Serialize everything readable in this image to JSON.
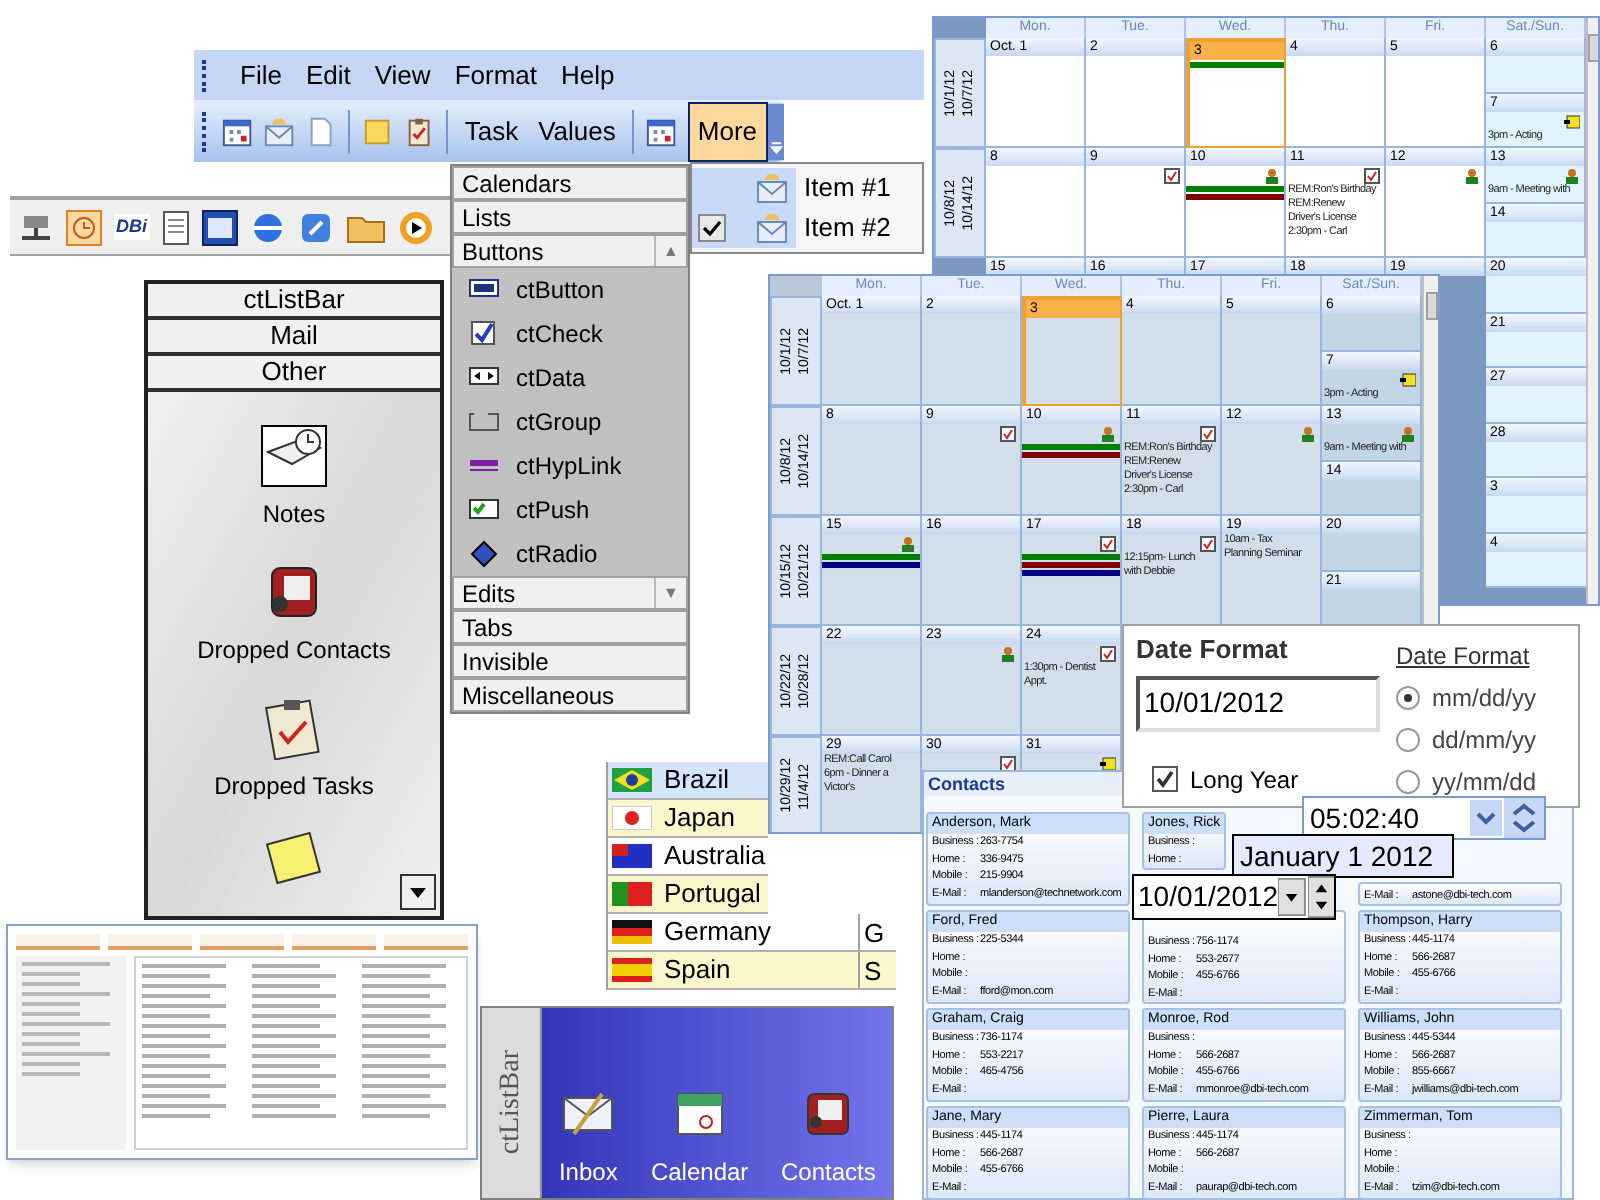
{
  "toolbar_window": {
    "menu": [
      {
        "label": "File"
      },
      {
        "label": "Edit"
      },
      {
        "label": "View"
      },
      {
        "label": "Format"
      },
      {
        "label": "Help"
      }
    ],
    "text_buttons": [
      {
        "label": "Task",
        "selected": false
      },
      {
        "label": "Values",
        "selected": false
      }
    ],
    "more_button": {
      "label": "More",
      "selected": true
    }
  },
  "more_menu": {
    "items": [
      {
        "label": "Item #1",
        "checked": false
      },
      {
        "label": "Item #2",
        "checked": true
      }
    ]
  },
  "quick_launch": {
    "logo": "DBi"
  },
  "group_bar": {
    "groups": [
      {
        "label": "Calendars"
      },
      {
        "label": "Lists"
      },
      {
        "label": "Buttons",
        "arrow": "▲",
        "items": [
          "ctButton",
          "ctCheck",
          "ctData",
          "ctGroup",
          "ctHypLink",
          "ctPush",
          "ctRadio"
        ]
      },
      {
        "label": "Edits",
        "arrow": "▼"
      },
      {
        "label": "Tabs"
      },
      {
        "label": "Invisible"
      },
      {
        "label": "Miscellaneous"
      }
    ]
  },
  "outlook_bar": {
    "groups": [
      "ctListBar",
      "Mail",
      "Other"
    ],
    "items": [
      "Notes",
      "Dropped Contacts",
      "Dropped Tasks"
    ]
  },
  "country_list": {
    "rows": [
      {
        "name": "Brazil",
        "selected": true
      },
      {
        "name": "Japan",
        "selected": false
      },
      {
        "name": "Australia",
        "selected": false
      },
      {
        "name": "Portugal",
        "selected": false
      },
      {
        "name": "Germany",
        "column_2": "G",
        "selected": false
      },
      {
        "name": "Spain",
        "column_2": "S",
        "selected": false
      }
    ]
  },
  "calendar_back": {
    "days": [
      "Mon.",
      "Tue.",
      "Wed.",
      "Thu.",
      "Fri.",
      "Sat./Sun."
    ],
    "weeks": [
      {
        "range": [
          "10/1/12",
          "10/7/12"
        ],
        "days": [
          {
            "label": "Oct. 1",
            "selected": false
          },
          {
            "label": "2",
            "selected": false
          },
          {
            "label": "3",
            "selected": true,
            "events": [
              {
                "kind": "bar",
                "color": "#008000"
              }
            ]
          },
          {
            "label": "4",
            "selected": false
          },
          {
            "label": "5",
            "selected": false
          },
          {
            "label": "6",
            "selected": false
          },
          {
            "label": "7",
            "selected": false,
            "events": [
              {
                "kind": "note"
              },
              {
                "kind": "text",
                "text": "3pm - Acting"
              }
            ]
          }
        ]
      },
      {
        "range": [
          "10/8/12",
          "10/14/12"
        ],
        "days": [
          {
            "label": "8",
            "selected": false
          },
          {
            "label": "9",
            "selected": false,
            "events": [
              {
                "kind": "task"
              }
            ]
          },
          {
            "label": "10",
            "selected": false,
            "events": [
              {
                "kind": "contact"
              },
              {
                "kind": "bar",
                "color": "#008000"
              },
              {
                "kind": "bar",
                "color": "#800000"
              }
            ]
          },
          {
            "label": "11",
            "selected": false,
            "events": [
              {
                "kind": "task"
              },
              {
                "kind": "text",
                "text": "REM:Ron's Birthday"
              },
              {
                "kind": "text",
                "text": "REM:Renew"
              },
              {
                "kind": "text",
                "text": "Driver's License"
              },
              {
                "kind": "text",
                "text": "2:30pm - Carl"
              }
            ]
          },
          {
            "label": "12",
            "selected": false,
            "events": [
              {
                "kind": "contact"
              }
            ]
          },
          {
            "label": "13",
            "selected": false,
            "events": [
              {
                "kind": "contact"
              },
              {
                "kind": "text",
                "text": "9am - Meeting with"
              }
            ]
          },
          {
            "label": "14",
            "selected": false
          }
        ]
      }
    ],
    "next_week_strip": [
      "15",
      "16",
      "17",
      "18",
      "19"
    ],
    "weekend_column": [
      "20",
      "21",
      "27",
      "28",
      "3",
      "4"
    ]
  },
  "calendar_front": {
    "days": [
      "Mon.",
      "Tue.",
      "Wed.",
      "Thu.",
      "Fri.",
      "Sat./Sun."
    ],
    "weeks": [
      {
        "range": [
          "10/1/12",
          "10/7/12"
        ],
        "days": [
          {
            "label": "Oct. 1",
            "selected": false
          },
          {
            "label": "2",
            "selected": false
          },
          {
            "label": "3",
            "selected": true
          },
          {
            "label": "4",
            "selected": false
          },
          {
            "label": "5",
            "selected": false
          },
          {
            "label": "6",
            "selected": false
          },
          {
            "label": "7",
            "selected": false,
            "events": [
              {
                "kind": "note"
              },
              {
                "kind": "text",
                "text": "3pm - Acting"
              }
            ]
          }
        ]
      },
      {
        "range": [
          "10/8/12",
          "10/14/12"
        ],
        "days": [
          {
            "label": "8",
            "selected": false
          },
          {
            "label": "9",
            "selected": false,
            "events": [
              {
                "kind": "task"
              }
            ]
          },
          {
            "label": "10",
            "selected": false,
            "events": [
              {
                "kind": "contact"
              },
              {
                "kind": "bar",
                "color": "#008000"
              },
              {
                "kind": "bar",
                "color": "#800000"
              }
            ]
          },
          {
            "label": "11",
            "selected": false,
            "events": [
              {
                "kind": "task"
              },
              {
                "kind": "text",
                "text": "REM:Ron's Birthday"
              },
              {
                "kind": "text",
                "text": "REM:Renew"
              },
              {
                "kind": "text",
                "text": "Driver's License"
              },
              {
                "kind": "text",
                "text": "2:30pm - Carl"
              }
            ]
          },
          {
            "label": "12",
            "selected": false,
            "events": [
              {
                "kind": "contact"
              }
            ]
          },
          {
            "label": "13",
            "selected": false,
            "events": [
              {
                "kind": "contact"
              },
              {
                "kind": "text",
                "text": "9am - Meeting with"
              }
            ]
          },
          {
            "label": "14",
            "selected": false
          }
        ]
      },
      {
        "range": [
          "10/15/12",
          "10/21/12"
        ],
        "days": [
          {
            "label": "15",
            "selected": false,
            "events": [
              {
                "kind": "contact"
              },
              {
                "kind": "bar",
                "color": "#008000"
              },
              {
                "kind": "bar",
                "color": "#000080"
              }
            ]
          },
          {
            "label": "16",
            "selected": false
          },
          {
            "label": "17",
            "selected": false,
            "events": [
              {
                "kind": "task"
              },
              {
                "kind": "bar",
                "color": "#008000"
              },
              {
                "kind": "bar",
                "color": "#800000"
              },
              {
                "kind": "bar",
                "color": "#000080"
              }
            ]
          },
          {
            "label": "18",
            "selected": false,
            "events": [
              {
                "kind": "task"
              },
              {
                "kind": "text",
                "text": "12:15pm- Lunch"
              },
              {
                "kind": "text",
                "text": "with Debbie"
              }
            ]
          },
          {
            "label": "19",
            "selected": false,
            "events": [
              {
                "kind": "text",
                "text": "10am - Tax"
              },
              {
                "kind": "text",
                "text": "Planning Seminar"
              }
            ]
          },
          {
            "label": "20",
            "selected": false
          },
          {
            "label": "21",
            "selected": false
          }
        ]
      },
      {
        "range": [
          "10/22/12",
          "10/28/12"
        ],
        "days": [
          {
            "label": "22",
            "selected": false
          },
          {
            "label": "23",
            "selected": false,
            "events": [
              {
                "kind": "contact"
              }
            ]
          },
          {
            "label": "24",
            "selected": false,
            "events": [
              {
                "kind": "task"
              },
              {
                "kind": "text",
                "text": "1:30pm - Dentist"
              },
              {
                "kind": "text",
                "text": "Appt."
              }
            ]
          }
        ]
      },
      {
        "range": [
          "10/29/12",
          "11/4/12"
        ],
        "days": [
          {
            "label": "29",
            "selected": false,
            "events": [
              {
                "kind": "text",
                "text": "REM:Call Carol"
              },
              {
                "kind": "text",
                "text": "6pm - Dinner a"
              },
              {
                "kind": "text",
                "text": "Victor's"
              }
            ]
          },
          {
            "label": "30",
            "selected": false,
            "events": [
              {
                "kind": "task"
              }
            ]
          },
          {
            "label": "31",
            "selected": false,
            "events": [
              {
                "kind": "note"
              }
            ]
          }
        ]
      }
    ]
  },
  "contacts": {
    "title": "Contacts",
    "columns": [
      [
        {
          "name": "Anderson, Mark",
          "fields": [
            {
              "label": "Business :",
              "value": "263-7754"
            },
            {
              "label": "Home :",
              "value": "336-9475"
            },
            {
              "label": "Mobile :",
              "value": "215-9904"
            },
            {
              "label": "E-Mail :",
              "value": "mlanderson@technetwork.com"
            }
          ]
        },
        {
          "name": "Ford, Fred",
          "fields": [
            {
              "label": "Business :",
              "value": "225-5344"
            },
            {
              "label": "Home :"
            },
            {
              "label": "Mobile :"
            },
            {
              "label": "E-Mail :",
              "value": "fford@mon.com"
            }
          ]
        },
        {
          "name": "Graham, Craig",
          "fields": [
            {
              "label": "Business :",
              "value": "736-1174"
            },
            {
              "label": "Home :",
              "value": "553-2217"
            },
            {
              "label": "Mobile :",
              "value": "465-4756"
            },
            {
              "label": "E-Mail :"
            }
          ]
        },
        {
          "name": "Jane, Mary",
          "fields": [
            {
              "label": "Business :",
              "value": "445-1174"
            },
            {
              "label": "Home :",
              "value": "566-2687"
            },
            {
              "label": "Mobile :",
              "value": "455-6766"
            },
            {
              "label": "E-Mail :"
            }
          ]
        }
      ],
      [
        {
          "name": "Jones, Rick",
          "fields": [
            {
              "label": "Business :"
            },
            {
              "label": "Home :"
            }
          ]
        },
        {
          "fields": [
            {
              "label": "Business :",
              "value": "756-1174"
            },
            {
              "label": "Home :",
              "value": "553-2677"
            },
            {
              "label": "Mobile :",
              "value": "455-6766"
            },
            {
              "label": "E-Mail :"
            }
          ]
        },
        {
          "name": "Monroe, Rod",
          "fields": [
            {
              "label": "Business :"
            },
            {
              "label": "Home :",
              "value": "566-2687"
            },
            {
              "label": "Mobile :",
              "value": "455-6766"
            },
            {
              "label": "E-Mail :",
              "value": "mmonroe@dbi-tech.com"
            }
          ]
        },
        {
          "name": "Pierre, Laura",
          "fields": [
            {
              "label": "Business :",
              "value": "445-1174"
            },
            {
              "label": "Home :",
              "value": "566-2687"
            },
            {
              "label": "Mobile :"
            },
            {
              "label": "E-Mail :",
              "value": "paurap@dbi-tech.com"
            }
          ]
        }
      ],
      [
        {
          "fields": [
            {
              "label": "E-Mail :",
              "value": "astone@dbi-tech.com"
            }
          ]
        },
        {
          "name": "Thompson, Harry",
          "fields": [
            {
              "label": "Business :",
              "value": "445-1174"
            },
            {
              "label": "Home :",
              "value": "566-2687"
            },
            {
              "label": "Mobile :",
              "value": "455-6766"
            },
            {
              "label": "E-Mail :"
            }
          ]
        },
        {
          "name": "Williams, John",
          "fields": [
            {
              "label": "Business :",
              "value": "445-5344"
            },
            {
              "label": "Home :",
              "value": "566-2687"
            },
            {
              "label": "Mobile :",
              "value": "855-6667"
            },
            {
              "label": "E-Mail :",
              "value": "jwilliams@dbi-tech.com"
            }
          ]
        },
        {
          "name": "Zimmerman, Tom",
          "fields": [
            {
              "label": "Business :"
            },
            {
              "label": "Home :"
            },
            {
              "label": "Mobile :"
            },
            {
              "label": "E-Mail :",
              "value": "tzim@dbi-tech.com"
            }
          ]
        }
      ]
    ]
  },
  "date_format_dialog": {
    "title": "Date Format",
    "date_value": "10/01/2012",
    "long_year": {
      "label": "Long Year",
      "checked": true
    },
    "options_title": "Date Format",
    "options": [
      {
        "label": "mm/dd/yy",
        "selected": true
      },
      {
        "label": "dd/mm/yy",
        "selected": false
      },
      {
        "label": "yy/mm/dd",
        "selected": false
      }
    ]
  },
  "time_field": {
    "value": "05:02:40"
  },
  "long_date_field": {
    "value": "January 1 2012"
  },
  "date_field": {
    "value": "10/01/2012"
  },
  "vertical_list_bar": {
    "title": "ctListBar",
    "items": [
      "Inbox",
      "Calendar",
      "Contacts"
    ]
  }
}
